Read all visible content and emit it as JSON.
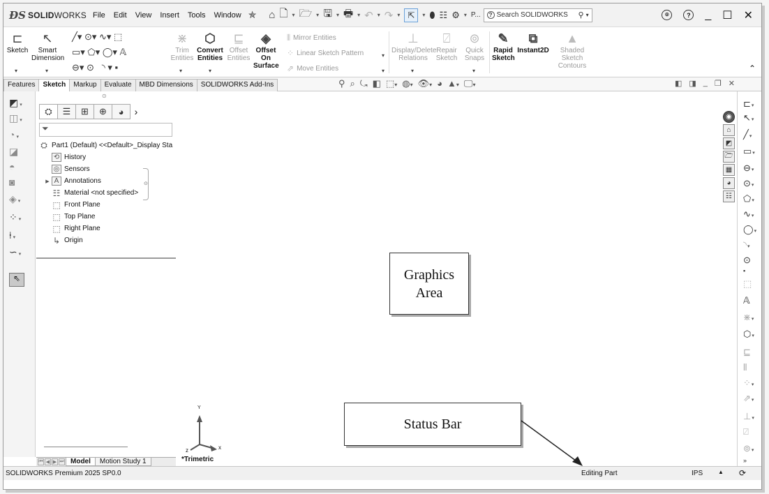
{
  "app": {
    "brand_bold": "SOLID",
    "brand_light": "WORKS"
  },
  "menu": [
    "File",
    "Edit",
    "View",
    "Insert",
    "Tools",
    "Window"
  ],
  "quick_access": {
    "options_abbrev": "P..."
  },
  "search": {
    "placeholder": "Search SOLIDWORKS"
  },
  "ribbon": {
    "sketch": "Sketch",
    "smart_dimension": "Smart Dimension",
    "trim_entities": "Trim Entities",
    "convert_entities": "Convert Entities",
    "offset_entities": "Offset Entities",
    "offset_on_surface": "Offset On Surface",
    "mirror_entities": "Mirror Entities",
    "linear_sketch_pattern": "Linear Sketch Pattern",
    "move_entities": "Move Entities",
    "display_delete_relations": "Display/Delete Relations",
    "repair_sketch": "Repair Sketch",
    "quick_snaps": "Quick Snaps",
    "rapid_sketch": "Rapid Sketch",
    "instant2d": "Instant2D",
    "shaded_sketch_contours": "Shaded Sketch Contours"
  },
  "command_tabs": [
    {
      "label": "Features",
      "active": false
    },
    {
      "label": "Sketch",
      "active": true
    },
    {
      "label": "Markup",
      "active": false
    },
    {
      "label": "Evaluate",
      "active": false
    },
    {
      "label": "MBD Dimensions",
      "active": false
    },
    {
      "label": "SOLIDWORKS Add-Ins",
      "active": false
    }
  ],
  "feature_tree": {
    "root": "Part1 (Default) <<Default>_Display Sta",
    "items": {
      "history": "History",
      "sensors": "Sensors",
      "annotations": "Annotations",
      "material": "Material <not specified>",
      "front_plane": "Front Plane",
      "top_plane": "Top Plane",
      "right_plane": "Right Plane",
      "origin": "Origin"
    }
  },
  "bottom_tabs": {
    "model": "Model",
    "motion_study": "Motion Study 1"
  },
  "graphics": {
    "callout_graphics_area_line1": "Graphics",
    "callout_graphics_area_line2": "Area",
    "callout_status_bar": "Status Bar",
    "view_orientation": "*Trimetric",
    "triad_x": "x",
    "triad_y": "Y",
    "triad_z": "z"
  },
  "status_bar": {
    "product": "SOLIDWORKS Premium 2025 SP0.0",
    "mode": "Editing Part",
    "units": "IPS"
  },
  "colors": {
    "active_tool": "#e6f0fa",
    "active_tool_border": "#6aa0d8"
  }
}
